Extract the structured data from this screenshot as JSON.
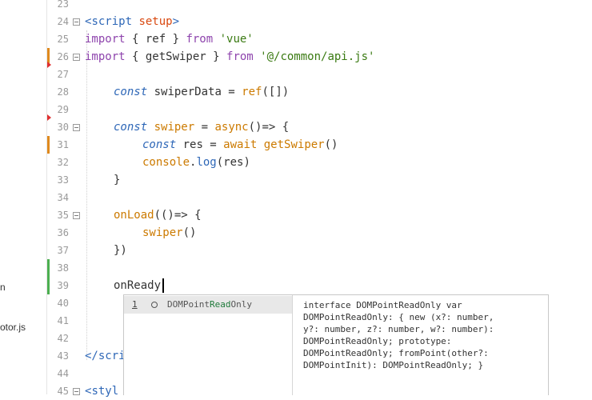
{
  "sidebar": {
    "files": [
      {
        "label": "n"
      },
      {
        "label": "otor.js"
      }
    ]
  },
  "editor": {
    "line_numbers": [
      "23",
      "24",
      "25",
      "26",
      "27",
      "28",
      "29",
      "30",
      "31",
      "32",
      "33",
      "34",
      "35",
      "36",
      "37",
      "38",
      "39",
      "40",
      "41",
      "42",
      "43",
      "44",
      "45"
    ],
    "lines": {
      "l24_open": "<",
      "l24_tag": "script",
      "l24_attr": "setup",
      "l24_close": ">",
      "l25_kw1": "import",
      "l25_mid": " { ref } ",
      "l25_kw2": "from",
      "l25_str": " 'vue'",
      "l26_kw1": "import",
      "l26_mid": " { getSwiper } ",
      "l26_kw2": "from",
      "l26_str": " '@/common/api.js'",
      "l28_kw": "const",
      "l28_mid": " swiperData = ",
      "l28_fn": "ref",
      "l28_end": "([])",
      "l30_kw": "const",
      "l30_var": " swiper",
      "l30_mid": " = ",
      "l30_fn": "async",
      "l30_end": "()=> {",
      "l31_kw": "const",
      "l31_mid": " res = ",
      "l31_fn": "await",
      "l31_fn2": " getSwiper",
      "l31_end": "()",
      "l32_obj": "console",
      "l32_dot": ".",
      "l32_fn": "log",
      "l32_end": "(res)",
      "l33": "}",
      "l35_fn": "onLoad",
      "l35_end": "(()=> {",
      "l36_fn": "swiper",
      "l36_end": "()",
      "l37": "})",
      "l39": "onReady",
      "l43_open": "</",
      "l43_tag": "scri",
      "l45_open": "<",
      "l45_tag": "styl"
    }
  },
  "autocomplete": {
    "index": "1",
    "kind_icon": "circle-icon",
    "label_prefix": "DOMPoint",
    "label_match": "Read",
    "label_suffix": "Only",
    "doc": "interface DOMPointReadOnly var\nDOMPointReadOnly: { new (x?: number,\ny?: number, z?: number, w?: number):\nDOMPointReadOnly; prototype:\nDOMPointReadOnly; fromPoint(other?:\nDOMPointInit): DOMPointReadOnly; }"
  },
  "colors": {
    "keyword": "#8e44ad",
    "tag": "#2e67b7",
    "string": "#3a7a12",
    "function": "#cc7a00",
    "modified_marker": "#e08a1e",
    "added_marker": "#4caf50",
    "error_marker": "#e03030"
  }
}
